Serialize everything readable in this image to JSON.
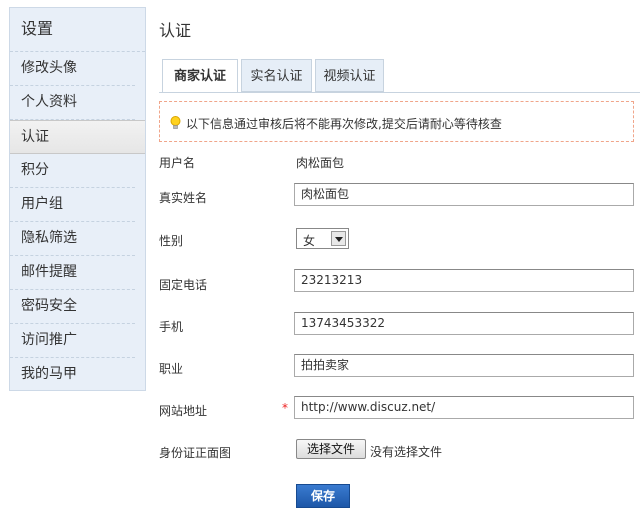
{
  "sidebar": {
    "title": "设置",
    "items": [
      {
        "label": "修改头像"
      },
      {
        "label": "个人资料"
      },
      {
        "label": "认证"
      },
      {
        "label": "积分"
      },
      {
        "label": "用户组"
      },
      {
        "label": "隐私筛选"
      },
      {
        "label": "邮件提醒"
      },
      {
        "label": "密码安全"
      },
      {
        "label": "访问推广"
      },
      {
        "label": "我的马甲"
      }
    ],
    "active_index": 2
  },
  "page": {
    "title": "认证"
  },
  "tabs": [
    {
      "label": "商家认证",
      "active": true
    },
    {
      "label": "实名认证",
      "active": false
    },
    {
      "label": "视频认证",
      "active": false
    }
  ],
  "notice": {
    "text": "以下信息通过审核后将不能再次修改,提交后请耐心等待核查"
  },
  "form": {
    "username": {
      "label": "用户名",
      "value": "肉松面包"
    },
    "realname": {
      "label": "真实姓名",
      "value": "肉松面包"
    },
    "gender": {
      "label": "性别",
      "value": "女"
    },
    "phone": {
      "label": "固定电话",
      "value": "23213213"
    },
    "mobile": {
      "label": "手机",
      "value": "13743453322"
    },
    "occupation": {
      "label": "职业",
      "value": "拍拍卖家"
    },
    "website": {
      "label": "网站地址",
      "value": "http://www.discuz.net/",
      "required_mark": "*"
    },
    "id_photo": {
      "label": "身份证正面图",
      "button": "选择文件",
      "status": "没有选择文件"
    },
    "save_label": "保存"
  },
  "colors": {
    "sidebar_bg": "#e8eff8",
    "notice_border": "#f0a58a",
    "save_button": "#2563b8",
    "required": "#e22222"
  }
}
